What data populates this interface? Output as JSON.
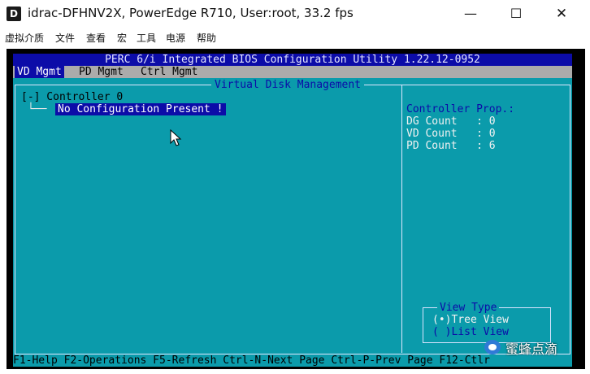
{
  "window": {
    "icon_letter": "D",
    "title": "idrac-DFHNV2X, PowerEdge R710, User:root, 33.2 fps",
    "controls": {
      "minimize": "—",
      "maximize": "☐",
      "close": "✕"
    }
  },
  "menubar": {
    "items": [
      "虚拟介质",
      "文件",
      "查看",
      "宏",
      "工具",
      "电源",
      "帮助"
    ]
  },
  "bios": {
    "title": "PERC 6/i Integrated BIOS Configuration Utility 1.22.12-0952",
    "tabs": [
      "VD Mgmt",
      "PD Mgmt",
      "Ctrl Mgmt"
    ],
    "active_tab": "VD Mgmt",
    "panel_title": "Virtual Disk Management",
    "tree": {
      "controller": "[-] Controller 0",
      "branch": "└──",
      "selected": "No Configuration Present !"
    },
    "properties": {
      "title": "Controller Prop.:",
      "rows": [
        "DG Count   : 0",
        "VD Count   : 0",
        "PD Count   : 6"
      ]
    },
    "view_type": {
      "title": "View Type",
      "tree_view": "(•)Tree View",
      "list_view": "( )List View"
    },
    "status_line": "F1-Help F2-Operations F5-Refresh Ctrl-N-Next Page Ctrl-P-Prev Page F12-Ctlr"
  },
  "watermark": {
    "text": "蜜蜂点滴"
  },
  "colors": {
    "bios_bg": "#0b9bab",
    "bios_blue": "#0c0ca8",
    "tab_gray": "#ababab"
  }
}
